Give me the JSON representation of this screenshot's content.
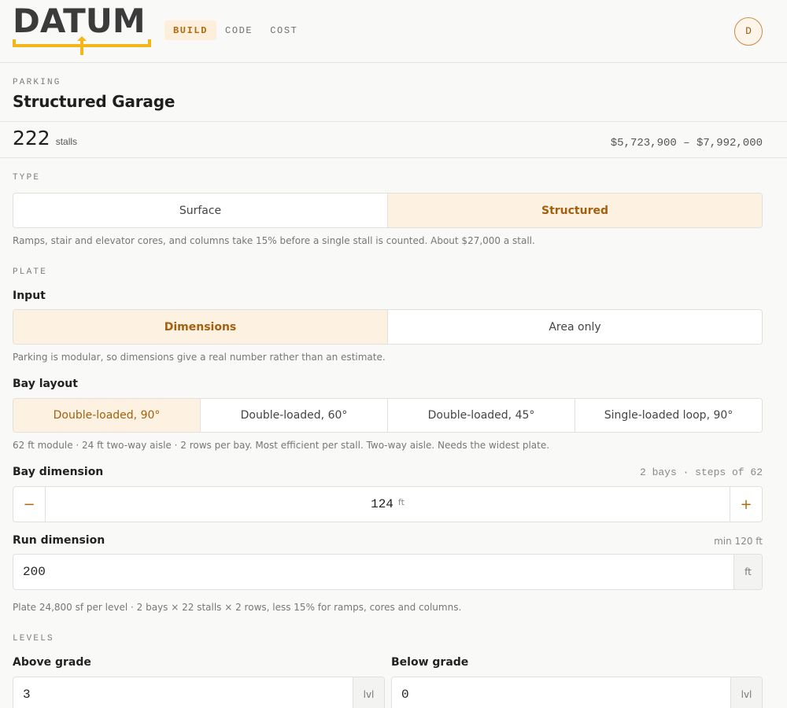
{
  "app": {
    "logo_text": "DATUM",
    "nav": [
      {
        "label": "BUILD",
        "active": true
      },
      {
        "label": "CODE",
        "active": false
      },
      {
        "label": "COST",
        "active": false
      }
    ],
    "avatar_initial": "D",
    "colors": {
      "accent": "#b06a14",
      "logo_bar": "#f2b619",
      "active_bg": "#fdf1e2"
    }
  },
  "header": {
    "eyebrow": "PARKING",
    "title": "Structured Garage"
  },
  "summary": {
    "stalls": "222",
    "stalls_unit": "stalls",
    "cost_range": "$5,723,900 – $7,992,000"
  },
  "type": {
    "section": "TYPE",
    "options": [
      {
        "label": "Surface",
        "active": false
      },
      {
        "label": "Structured",
        "active": true
      }
    ],
    "help": "Ramps, stair and elevator cores, and columns take 15% before a single stall is counted. About $27,000 a stall."
  },
  "plate": {
    "section": "PLATE",
    "input_label": "Input",
    "input_options": [
      {
        "label": "Dimensions",
        "active": true
      },
      {
        "label": "Area only",
        "active": false
      }
    ],
    "input_help": "Parking is modular, so dimensions give a real number rather than an estimate.",
    "bay_layout_label": "Bay layout",
    "bay_layouts": [
      {
        "label": "Double-loaded, 90°",
        "active": true
      },
      {
        "label": "Double-loaded, 60°",
        "active": false
      },
      {
        "label": "Double-loaded, 45°",
        "active": false
      },
      {
        "label": "Single-loaded loop, 90°",
        "active": false
      }
    ],
    "bay_layout_help": "62 ft module · 24 ft two-way aisle · 2 rows per bay. Most efficient per stall. Two-way aisle. Needs the widest plate.",
    "bay_dimension_label": "Bay dimension",
    "bay_dimension_hint": "2 bays · steps of 62",
    "bay_dimension_value": "124",
    "bay_dimension_unit": "ft",
    "minus": "−",
    "plus": "+",
    "run_dimension_label": "Run dimension",
    "run_dimension_hint": "min 120 ft",
    "run_dimension_value": "200",
    "run_dimension_unit": "ft",
    "plate_help": "Plate 24,800 sf per level · 2 bays × 22 stalls × 2 rows, less 15% for ramps, cores and columns."
  },
  "levels": {
    "section": "LEVELS",
    "above_label": "Above grade",
    "above_value": "3",
    "above_unit": "lvl",
    "below_label": "Below grade",
    "below_value": "0",
    "below_unit": "lvl"
  }
}
